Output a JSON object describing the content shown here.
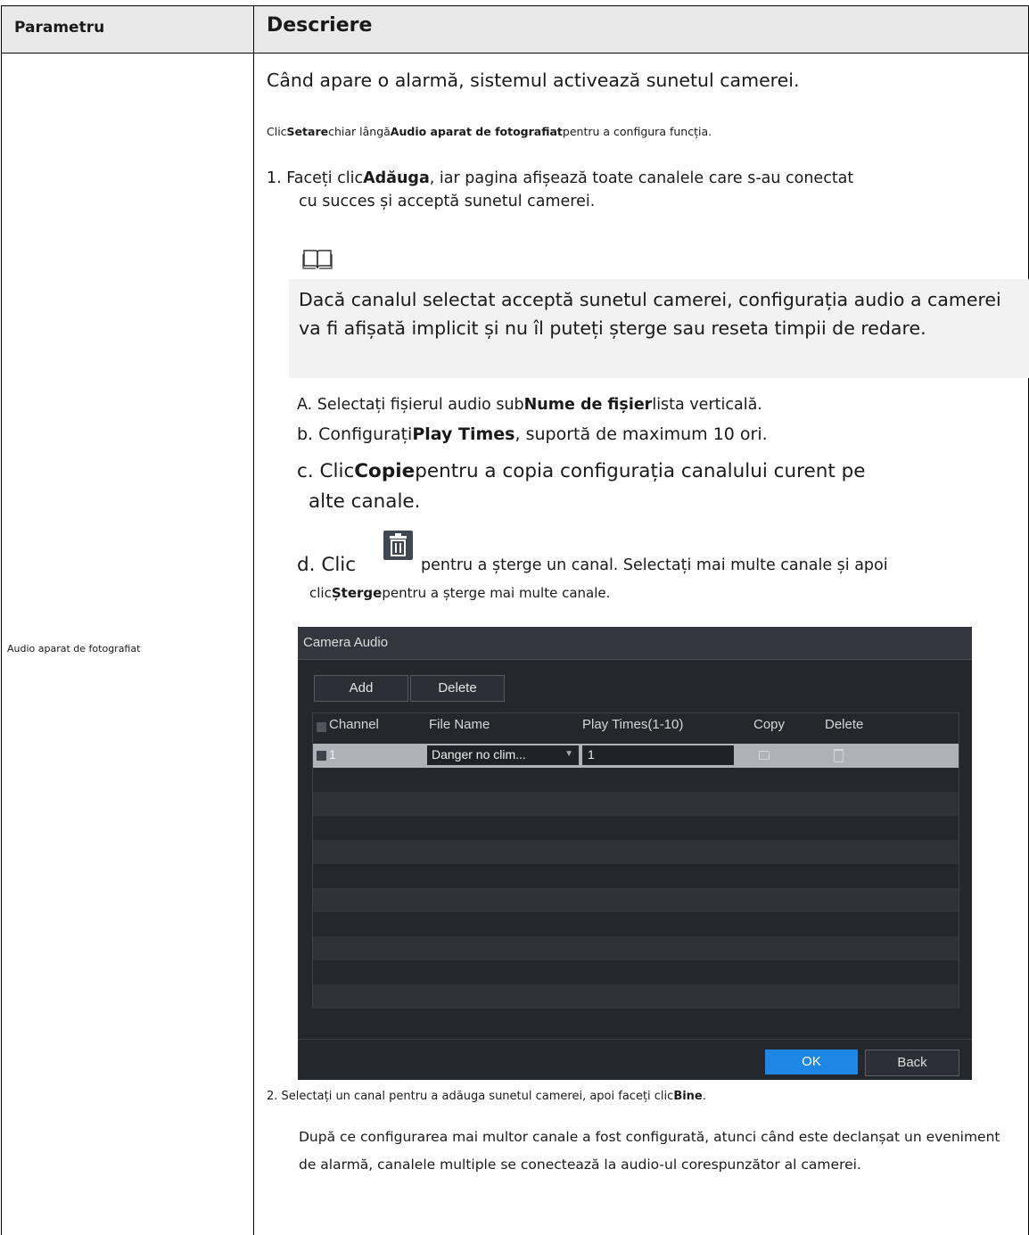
{
  "table": {
    "header_param": "Parametru",
    "header_desc": "Descriere",
    "param_name": "Audio aparat de fotografiat"
  },
  "description": {
    "intro": "Când apare o alarmă, sistemul activează sunetul camerei.",
    "setup_pre": "Clic",
    "setup_bold1": "Setare",
    "setup_mid": "chiar lângă",
    "setup_bold2": "Audio aparat de fotografiat",
    "setup_post": "pentru a configura funcția.",
    "step1_pre": "1. Faceți clic",
    "step1_bold": "Adăuga",
    "step1_post": ", iar pagina afișează toate canalele care s-au conectat",
    "step1_line2": "cu succes și acceptă sunetul camerei.",
    "note": "Dacă canalul selectat acceptă sunetul camerei, configurația audio a camerei va fi afișată implicit și nu îl puteți șterge sau reseta timpii de redare.",
    "a_pre": "A. Selectați fișierul audio sub",
    "a_bold": "Nume de fișier",
    "a_post": "lista verticală.",
    "b_pre": "b. Configurați",
    "b_bold": "Play Times",
    "b_post": ", suportă de maximum 10 ori.",
    "c_pre": "c. Clic",
    "c_bold": "Copie",
    "c_post": "pentru a copia configurația canalului curent pe",
    "c_line2": "alte canale.",
    "d_pre": "d. Clic",
    "d_post": "pentru a șterge un canal. Selectați mai multe canale și apoi",
    "d2_pre": "clic",
    "d2_bold": "Șterge",
    "d2_post": "pentru a șterge mai multe canale.",
    "step2_pre": "2. Selectați un canal pentru a adăuga sunetul camerei, apoi faceți clic",
    "step2_bold": "Bine",
    "step2_post": ".",
    "final": "După ce configurarea mai multor canale a fost configurată, atunci când este declanșat un eveniment de alarmă, canalele multiple se conectează la audio-ul corespunzător al camerei."
  },
  "dialog": {
    "title": "Camera Audio",
    "add_label": "Add",
    "delete_label": "Delete",
    "columns": [
      "Channel",
      "File Name",
      "Play Times(1-10)",
      "Copy",
      "Delete"
    ],
    "row": {
      "channel": "1",
      "file_name": "Danger no clim...",
      "play_times": "1"
    },
    "ok_label": "OK",
    "back_label": "Back"
  },
  "icons": {
    "note": "book-icon",
    "trash": "trash-icon"
  },
  "colors": {
    "dialog_bg": "#24272c",
    "ok_button": "#1e86e5",
    "header_bg": "#e9e9e9"
  }
}
